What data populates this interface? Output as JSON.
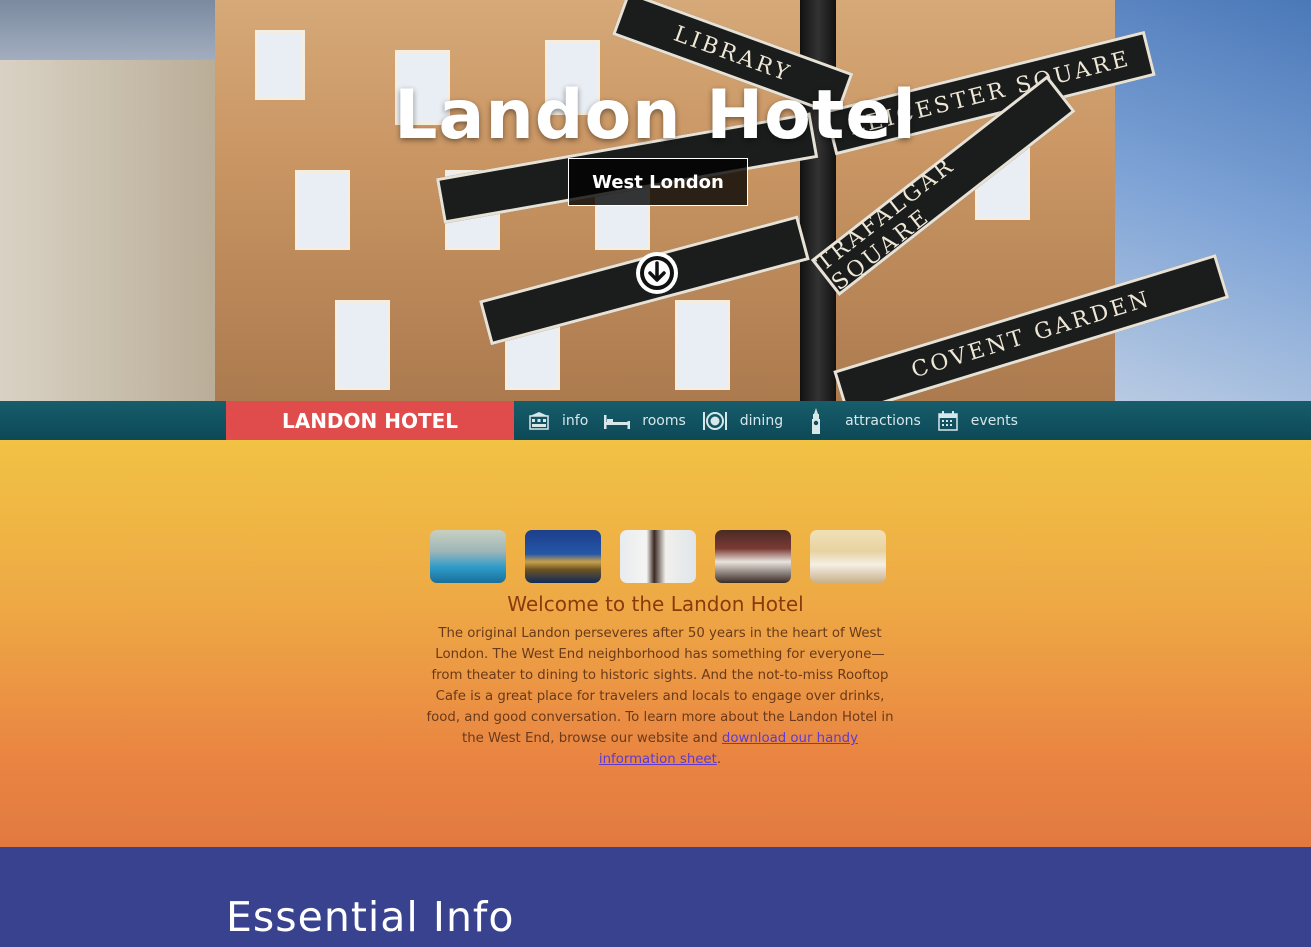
{
  "hero": {
    "title": "Landon Hotel",
    "subtitle": "West London",
    "signs": [
      "LIBRARY",
      "LEICESTER SQUARE",
      "TRAFALGAR SQUARE",
      "COVENT GARDEN"
    ]
  },
  "nav": {
    "brand": "LANDON HOTEL",
    "items": [
      {
        "label": "info",
        "icon": "hotel-icon"
      },
      {
        "label": "rooms",
        "icon": "bed-icon"
      },
      {
        "label": "dining",
        "icon": "plate-icon"
      },
      {
        "label": "attractions",
        "icon": "big-ben-icon"
      },
      {
        "label": "events",
        "icon": "calendar-icon"
      }
    ]
  },
  "welcome": {
    "heading": "Welcome to the Landon Hotel",
    "body_text": "The original Landon perseveres after 50 years in the heart of West London. The West End neighborhood has something for everyone—from theater to dining to historic sights. And the not-to-miss Rooftop Cafe is a great place for travelers and locals to engage over drinks, food, and good conversation. To learn more about the Landon Hotel in the West End, browse our website and ",
    "link_text": "download our handy information sheet",
    "body_end": ".",
    "thumbnails": [
      "pool-photo",
      "parliament-photo",
      "wedding-photo",
      "room-photo",
      "ballroom-photo"
    ]
  },
  "essential": {
    "heading": "Essential Info"
  },
  "colors": {
    "brand": "#e04c4c",
    "nav": "#0d4957",
    "essential_bg": "#39428f",
    "link": "#5b3bd4"
  }
}
